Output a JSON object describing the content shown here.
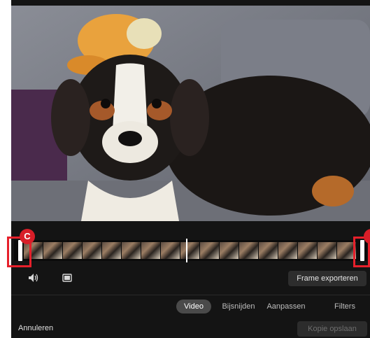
{
  "callouts": {
    "left": "C",
    "right": ""
  },
  "toolbar": {
    "volume_icon": "volume-icon",
    "frame_icon": "frame-capture-icon",
    "export_label": "Frame exporteren"
  },
  "tabs": [
    {
      "label": "Video",
      "active": true
    },
    {
      "label": "Bijsnijden",
      "active": false
    },
    {
      "label": "Aanpassen",
      "active": false
    },
    {
      "label": "Filters",
      "active": false
    }
  ],
  "footer": {
    "cancel_label": "Annuleren",
    "save_label": "Kopie opslaan"
  },
  "colors": {
    "callout_red": "#e6202b",
    "background": "#141414"
  }
}
